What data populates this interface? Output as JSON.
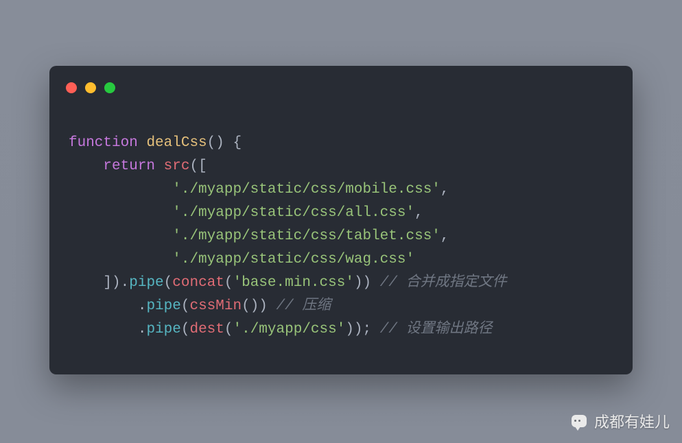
{
  "watermark": {
    "text": "成都有娃儿"
  },
  "colors": {
    "background_from": "#878d99",
    "background_to": "#868c98",
    "card_bg": "#282c34",
    "dot_red": "#ff5f56",
    "dot_yellow": "#ffbd2e",
    "dot_green": "#27c93f",
    "token_keyword": "#c678dd",
    "token_fname": "#e5c07b",
    "token_punc": "#abb2bf",
    "token_call_blue": "#56b6c2",
    "token_call_red": "#e06c75",
    "token_string": "#98c379",
    "token_comment": "#6f7682"
  },
  "code": {
    "line1": {
      "kw": "function",
      "sp": " ",
      "name": "dealCss",
      "after": "() {"
    },
    "line2": {
      "indent": "    ",
      "kw": "return",
      "sp": " ",
      "call": "src",
      "after": "(["
    },
    "line3": {
      "indent": "            ",
      "str": "'./myapp/static/css/mobile.css'",
      "comma": ","
    },
    "line4": {
      "indent": "            ",
      "str": "'./myapp/static/css/all.css'",
      "comma": ","
    },
    "line5": {
      "indent": "            ",
      "str": "'./myapp/static/css/tablet.css'",
      "comma": ","
    },
    "line6": {
      "indent": "            ",
      "str": "'./myapp/static/css/wag.css'"
    },
    "line7": {
      "indent": "    ",
      "close": "])",
      "dot1": ".",
      "pipe1": "pipe",
      "open1": "(",
      "concat": "concat",
      "open2": "(",
      "arg": "'base.min.css'",
      "close2": "))",
      "sp": " ",
      "comment": "// 合并成指定文件"
    },
    "line8": {
      "indent": "        ",
      "dot1": ".",
      "pipe1": "pipe",
      "open1": "(",
      "cssmin": "cssMin",
      "close1": "())",
      "sp": " ",
      "comment": "// 压缩"
    },
    "line9": {
      "indent": "        ",
      "dot1": ".",
      "pipe1": "pipe",
      "open1": "(",
      "dest": "dest",
      "open2": "(",
      "arg": "'./myapp/css'",
      "close2": "));",
      "sp": " ",
      "comment": "// 设置输出路径"
    }
  }
}
